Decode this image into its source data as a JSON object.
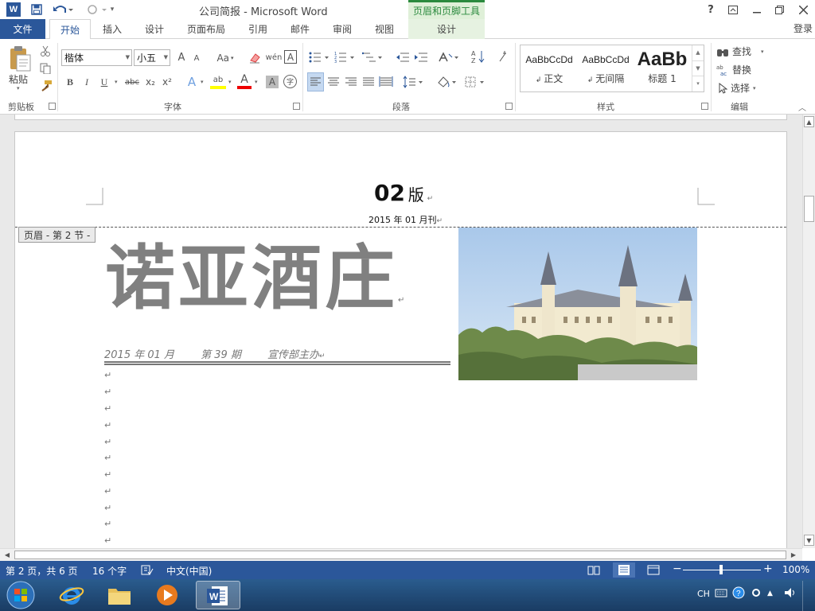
{
  "window": {
    "title": "公司简报 - Microsoft Word",
    "context_tools_title": "页眉和页脚工具",
    "help": "?",
    "signin": "登录"
  },
  "tabs": {
    "file": "文件",
    "home": "开始",
    "insert": "插入",
    "design": "设计",
    "layout": "页面布局",
    "references": "引用",
    "mailings": "邮件",
    "review": "审阅",
    "view": "视图",
    "ctx_design": "设计"
  },
  "ribbon": {
    "clipboard": {
      "paste": "粘贴",
      "label": "剪贴板"
    },
    "font": {
      "name": "楷体",
      "size": "小五",
      "label": "字体",
      "bold": "B",
      "italic": "I",
      "underline": "U",
      "strike": "abc",
      "subscript": "x₂",
      "superscript": "x²",
      "grow": "A",
      "shrink": "A",
      "case": "Aa",
      "phonetic": "wén",
      "border_char": "A",
      "highlight": "ab",
      "font_color": "A",
      "shading": "A",
      "enclose": "字"
    },
    "paragraph": {
      "label": "段落"
    },
    "styles": {
      "label": "样式",
      "items": [
        {
          "sample": "AaBbCcDd",
          "name": "正文"
        },
        {
          "sample": "AaBbCcDd",
          "name": "无间隔"
        },
        {
          "sample": "AaBb",
          "name": "标题 1"
        }
      ]
    },
    "editing": {
      "find": "查找",
      "replace": "替换",
      "select": "选择",
      "label": "编辑"
    }
  },
  "document": {
    "edition": "02",
    "edition_suffix": "版",
    "edition_mark": "↵",
    "date_line": "2015 年 01 月刊",
    "date_mark": "↵",
    "header_tag": "页眉 - 第 2 节 -",
    "banner": "诺亚酒庄",
    "banner_mark": "↵",
    "issue_line": "2015 年 01 月        第 39 期        宣传部主办",
    "issue_mark": "↵",
    "paragraph_mark": "↵"
  },
  "statusbar": {
    "page": "第 2 页，共 6 页",
    "words": "16 个字",
    "language": "中文(中国)",
    "zoom": "100%"
  },
  "taskbar": {
    "lang": "CH"
  },
  "colors": {
    "accent": "#2b579a",
    "context_green": "#2b8a3e"
  }
}
